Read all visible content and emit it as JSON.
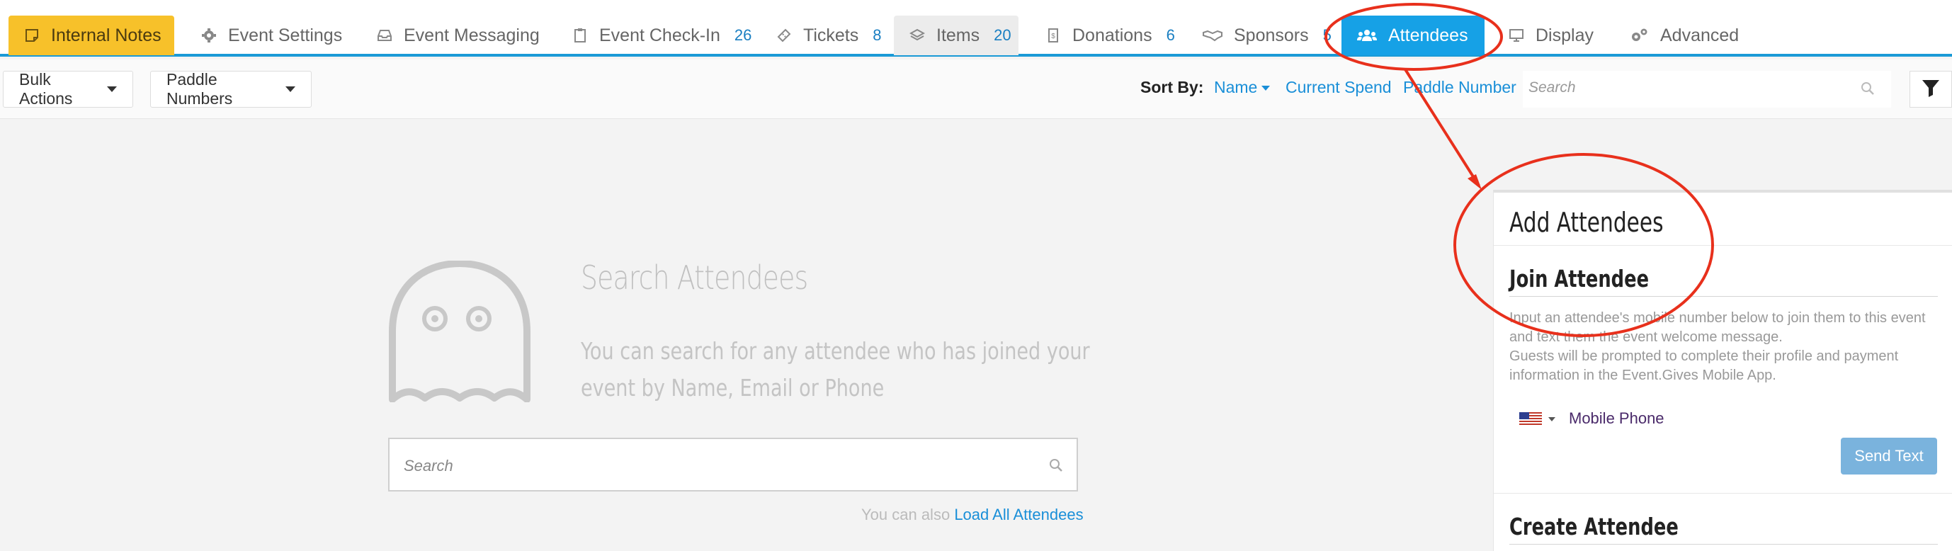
{
  "tabs": [
    {
      "label": "Internal Notes",
      "icon": "note-icon",
      "count": ""
    },
    {
      "label": "Event Settings",
      "icon": "gear-icon",
      "count": ""
    },
    {
      "label": "Event Messaging",
      "icon": "inbox-icon",
      "count": ""
    },
    {
      "label": "Event Check-In",
      "icon": "clipboard-icon",
      "count": "26"
    },
    {
      "label": "Tickets",
      "icon": "ticket-icon",
      "count": "8"
    },
    {
      "label": "Items",
      "icon": "layers-icon",
      "count": "20"
    },
    {
      "label": "Donations",
      "icon": "donation-icon",
      "count": "6"
    },
    {
      "label": "Sponsors",
      "icon": "handshake-icon",
      "count": "5"
    },
    {
      "label": "Attendees",
      "icon": "users-icon",
      "count": ""
    },
    {
      "label": "Display",
      "icon": "monitor-icon",
      "count": ""
    },
    {
      "label": "Advanced",
      "icon": "cogs-icon",
      "count": ""
    }
  ],
  "active_tab": "Attendees",
  "toolbar": {
    "bulk_actions": "Bulk Actions",
    "paddle_numbers": "Paddle Numbers",
    "sort_by_label": "Sort By:",
    "sort_options": [
      "Name",
      "Current Spend",
      "Paddle Number"
    ],
    "search_placeholder": "Search"
  },
  "empty_state": {
    "title": "Search Attendees",
    "subtitle": "You can search for any attendee who has joined your event by Name, Email or Phone",
    "search_placeholder": "Search",
    "load_prefix": "You can also",
    "load_link": "Load All Attendees"
  },
  "panel": {
    "title": "Add Attendees",
    "join_heading": "Join Attendee",
    "join_desc_1": "Input an attendee's mobile number below to join them to this event and text them the event welcome message.",
    "join_desc_2": "Guests will be prompted to complete their profile and payment information in the Event.Gives Mobile App.",
    "phone_placeholder": "Mobile Phone",
    "send_button": "Send Text",
    "create_heading": "Create Attendee"
  },
  "colors": {
    "accent": "#16a1e6",
    "notes_tab": "#f7c12a",
    "link": "#1a8fd8",
    "annotation": "#e8301c",
    "send_button": "#7ab3dd"
  }
}
